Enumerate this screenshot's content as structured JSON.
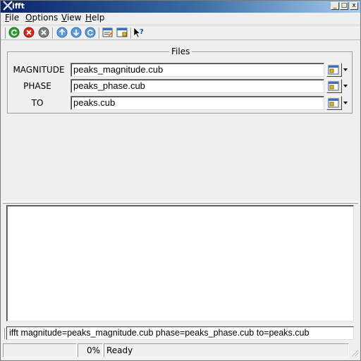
{
  "window": {
    "title": "ifft",
    "minimize_label": "_",
    "maximize_label": "□",
    "close_label": "x"
  },
  "menu": {
    "file": {
      "mnemonic": "F",
      "rest": "ile"
    },
    "options": {
      "mnemonic": "O",
      "rest": "ptions"
    },
    "view": {
      "mnemonic": "V",
      "rest": "iew"
    },
    "help": {
      "mnemonic": "H",
      "rest": "elp"
    }
  },
  "toolbar": {
    "icons": [
      "run-icon",
      "stop-icon",
      "exit-icon",
      "previous-history-icon",
      "next-history-icon",
      "reset-icon",
      "save-parameters-icon",
      "display-log-icon",
      "whats-this-icon"
    ]
  },
  "files": {
    "legend": "Files",
    "rows": [
      {
        "label": "MAGNITUDE",
        "value": "peaks_magnitude.cub"
      },
      {
        "label": "PHASE",
        "value": "peaks_phase.cub"
      },
      {
        "label": "TO",
        "value": "peaks.cub"
      }
    ]
  },
  "log": {
    "text": ""
  },
  "command_line": "ifft magnitude=peaks_magnitude.cub phase=peaks_phase.cub to=peaks.cub",
  "status": {
    "progress": "0%",
    "progress_value": 0,
    "message": "Ready"
  },
  "colors": {
    "title_bar_start": "#0a246a",
    "title_bar_end": "#a6caf0",
    "window_bg": "#efefef"
  }
}
